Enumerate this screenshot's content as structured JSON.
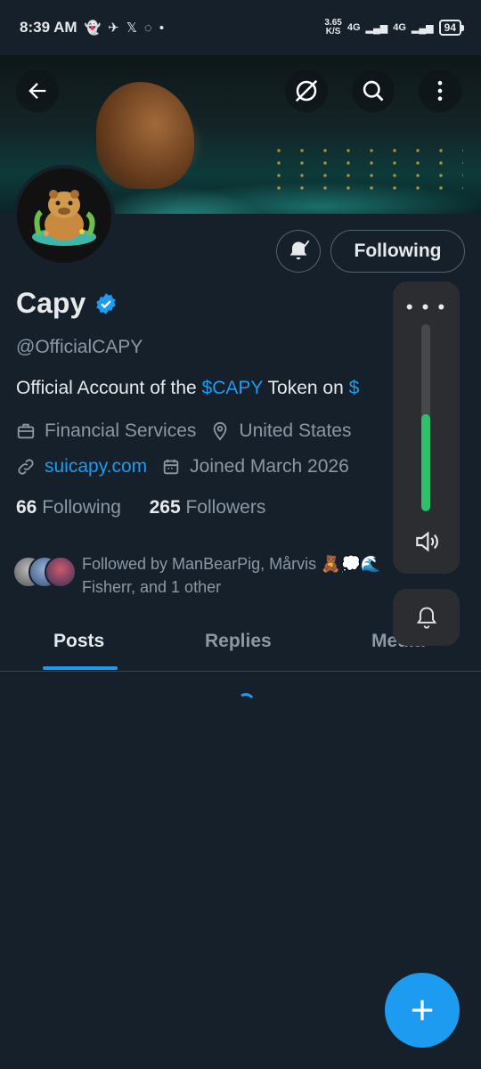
{
  "status_bar": {
    "time": "8:39 AM",
    "speed_value": "3.65",
    "speed_unit": "K/S",
    "network_1": "4G",
    "network_2": "4G",
    "battery": "94"
  },
  "banner": {
    "back_icon": "arrow-left-icon",
    "translate_icon": "grok-icon",
    "search_icon": "search-icon",
    "more_icon": "more-vertical-icon"
  },
  "profile": {
    "name": "Capy",
    "verified": true,
    "handle": "@OfficialCAPY",
    "bio_prefix": "Official Account of the ",
    "bio_cashtag": "$CAPY",
    "bio_suffix": " Token on ",
    "bio_trailing": "$",
    "category": "Financial Services",
    "location": "United States",
    "website": "suicapy.com",
    "joined": "Joined March 2026",
    "following_count": "66",
    "following_label": " Following",
    "followers_count": "265",
    "followers_label": " Followers",
    "followed_by": "Followed by ManBearPig, Mårvis 🧸💭🌊 Fisherr, and 1 other"
  },
  "actions": {
    "following_button": "Following"
  },
  "tabs": [
    {
      "label": "Posts",
      "active": true
    },
    {
      "label": "Replies",
      "active": false
    },
    {
      "label": "Media",
      "active": false
    }
  ],
  "volume_overlay": {
    "more_label": "• • •",
    "level": 0.52
  },
  "colors": {
    "background": "#15202b",
    "accent": "#1d9bf0",
    "volume_fill": "#2bc26a",
    "secondary_text": "#8b98a5"
  }
}
